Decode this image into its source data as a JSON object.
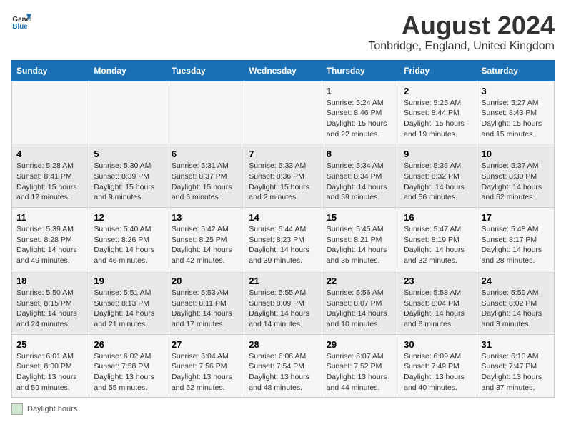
{
  "header": {
    "logo_general": "General",
    "logo_blue": "Blue",
    "title": "August 2024",
    "subtitle": "Tonbridge, England, United Kingdom"
  },
  "legend": {
    "label": "Daylight hours"
  },
  "columns": [
    "Sunday",
    "Monday",
    "Tuesday",
    "Wednesday",
    "Thursday",
    "Friday",
    "Saturday"
  ],
  "weeks": [
    {
      "days": [
        {
          "num": "",
          "info": ""
        },
        {
          "num": "",
          "info": ""
        },
        {
          "num": "",
          "info": ""
        },
        {
          "num": "",
          "info": ""
        },
        {
          "num": "1",
          "info": "Sunrise: 5:24 AM\nSunset: 8:46 PM\nDaylight: 15 hours\nand 22 minutes."
        },
        {
          "num": "2",
          "info": "Sunrise: 5:25 AM\nSunset: 8:44 PM\nDaylight: 15 hours\nand 19 minutes."
        },
        {
          "num": "3",
          "info": "Sunrise: 5:27 AM\nSunset: 8:43 PM\nDaylight: 15 hours\nand 15 minutes."
        }
      ]
    },
    {
      "days": [
        {
          "num": "4",
          "info": "Sunrise: 5:28 AM\nSunset: 8:41 PM\nDaylight: 15 hours\nand 12 minutes."
        },
        {
          "num": "5",
          "info": "Sunrise: 5:30 AM\nSunset: 8:39 PM\nDaylight: 15 hours\nand 9 minutes."
        },
        {
          "num": "6",
          "info": "Sunrise: 5:31 AM\nSunset: 8:37 PM\nDaylight: 15 hours\nand 6 minutes."
        },
        {
          "num": "7",
          "info": "Sunrise: 5:33 AM\nSunset: 8:36 PM\nDaylight: 15 hours\nand 2 minutes."
        },
        {
          "num": "8",
          "info": "Sunrise: 5:34 AM\nSunset: 8:34 PM\nDaylight: 14 hours\nand 59 minutes."
        },
        {
          "num": "9",
          "info": "Sunrise: 5:36 AM\nSunset: 8:32 PM\nDaylight: 14 hours\nand 56 minutes."
        },
        {
          "num": "10",
          "info": "Sunrise: 5:37 AM\nSunset: 8:30 PM\nDaylight: 14 hours\nand 52 minutes."
        }
      ]
    },
    {
      "days": [
        {
          "num": "11",
          "info": "Sunrise: 5:39 AM\nSunset: 8:28 PM\nDaylight: 14 hours\nand 49 minutes."
        },
        {
          "num": "12",
          "info": "Sunrise: 5:40 AM\nSunset: 8:26 PM\nDaylight: 14 hours\nand 46 minutes."
        },
        {
          "num": "13",
          "info": "Sunrise: 5:42 AM\nSunset: 8:25 PM\nDaylight: 14 hours\nand 42 minutes."
        },
        {
          "num": "14",
          "info": "Sunrise: 5:44 AM\nSunset: 8:23 PM\nDaylight: 14 hours\nand 39 minutes."
        },
        {
          "num": "15",
          "info": "Sunrise: 5:45 AM\nSunset: 8:21 PM\nDaylight: 14 hours\nand 35 minutes."
        },
        {
          "num": "16",
          "info": "Sunrise: 5:47 AM\nSunset: 8:19 PM\nDaylight: 14 hours\nand 32 minutes."
        },
        {
          "num": "17",
          "info": "Sunrise: 5:48 AM\nSunset: 8:17 PM\nDaylight: 14 hours\nand 28 minutes."
        }
      ]
    },
    {
      "days": [
        {
          "num": "18",
          "info": "Sunrise: 5:50 AM\nSunset: 8:15 PM\nDaylight: 14 hours\nand 24 minutes."
        },
        {
          "num": "19",
          "info": "Sunrise: 5:51 AM\nSunset: 8:13 PM\nDaylight: 14 hours\nand 21 minutes."
        },
        {
          "num": "20",
          "info": "Sunrise: 5:53 AM\nSunset: 8:11 PM\nDaylight: 14 hours\nand 17 minutes."
        },
        {
          "num": "21",
          "info": "Sunrise: 5:55 AM\nSunset: 8:09 PM\nDaylight: 14 hours\nand 14 minutes."
        },
        {
          "num": "22",
          "info": "Sunrise: 5:56 AM\nSunset: 8:07 PM\nDaylight: 14 hours\nand 10 minutes."
        },
        {
          "num": "23",
          "info": "Sunrise: 5:58 AM\nSunset: 8:04 PM\nDaylight: 14 hours\nand 6 minutes."
        },
        {
          "num": "24",
          "info": "Sunrise: 5:59 AM\nSunset: 8:02 PM\nDaylight: 14 hours\nand 3 minutes."
        }
      ]
    },
    {
      "days": [
        {
          "num": "25",
          "info": "Sunrise: 6:01 AM\nSunset: 8:00 PM\nDaylight: 13 hours\nand 59 minutes."
        },
        {
          "num": "26",
          "info": "Sunrise: 6:02 AM\nSunset: 7:58 PM\nDaylight: 13 hours\nand 55 minutes."
        },
        {
          "num": "27",
          "info": "Sunrise: 6:04 AM\nSunset: 7:56 PM\nDaylight: 13 hours\nand 52 minutes."
        },
        {
          "num": "28",
          "info": "Sunrise: 6:06 AM\nSunset: 7:54 PM\nDaylight: 13 hours\nand 48 minutes."
        },
        {
          "num": "29",
          "info": "Sunrise: 6:07 AM\nSunset: 7:52 PM\nDaylight: 13 hours\nand 44 minutes."
        },
        {
          "num": "30",
          "info": "Sunrise: 6:09 AM\nSunset: 7:49 PM\nDaylight: 13 hours\nand 40 minutes."
        },
        {
          "num": "31",
          "info": "Sunrise: 6:10 AM\nSunset: 7:47 PM\nDaylight: 13 hours\nand 37 minutes."
        }
      ]
    }
  ]
}
